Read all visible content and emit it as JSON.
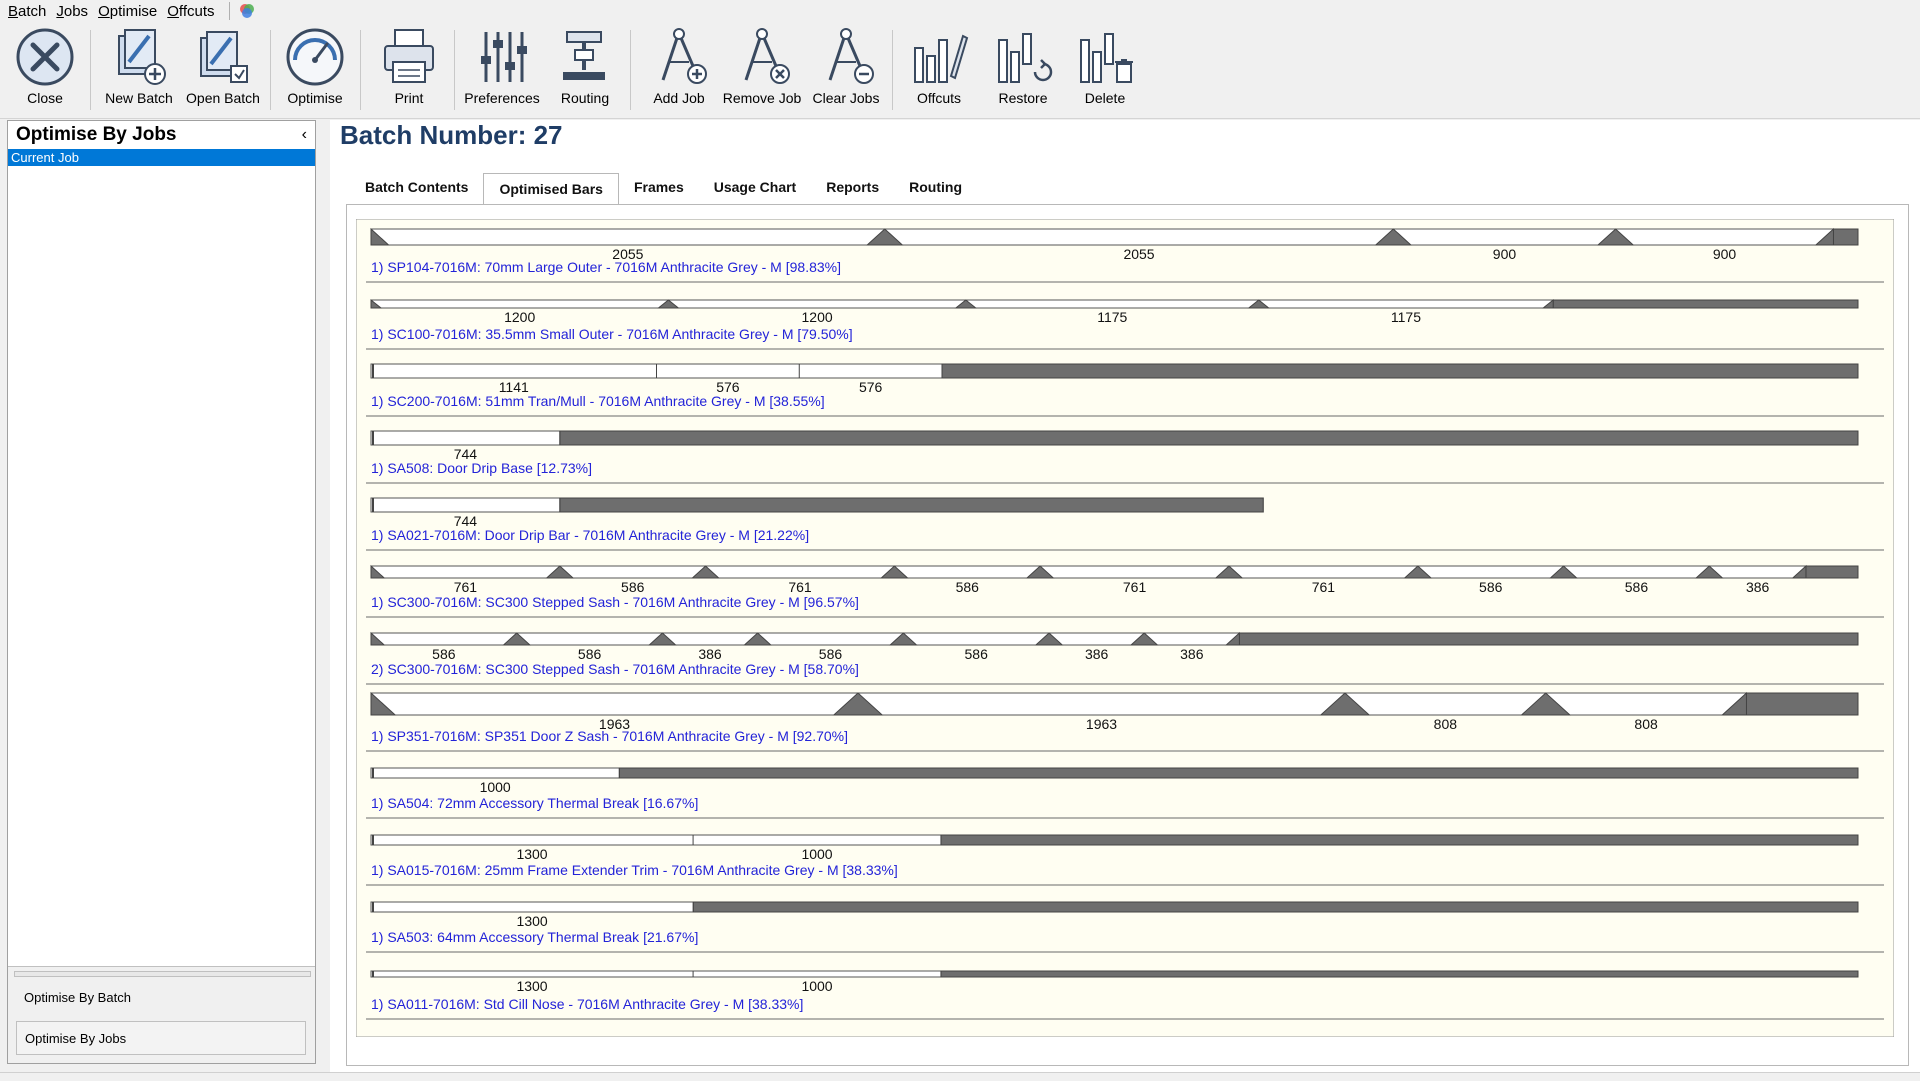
{
  "menu": [
    "Batch",
    "Jobs",
    "Optimise",
    "Offcuts"
  ],
  "toolbar": [
    {
      "id": "close",
      "label": "Close",
      "icon": "close-icon"
    },
    {
      "id": "new-batch",
      "label": "New Batch",
      "icon": "new-batch-icon"
    },
    {
      "id": "open-batch",
      "label": "Open Batch",
      "icon": "open-batch-icon"
    },
    {
      "id": "optimise",
      "label": "Optimise",
      "icon": "gauge-icon"
    },
    {
      "id": "print",
      "label": "Print",
      "icon": "printer-icon"
    },
    {
      "id": "preferences",
      "label": "Preferences",
      "icon": "sliders-icon"
    },
    {
      "id": "routing",
      "label": "Routing",
      "icon": "routing-icon"
    },
    {
      "id": "add-job",
      "label": "Add Job",
      "icon": "compass-add-icon"
    },
    {
      "id": "remove-job",
      "label": "Remove Job",
      "icon": "compass-remove-icon"
    },
    {
      "id": "clear-jobs",
      "label": "Clear Jobs",
      "icon": "compass-clear-icon"
    },
    {
      "id": "offcuts",
      "label": "Offcuts",
      "icon": "offcuts-icon"
    },
    {
      "id": "restore",
      "label": "Restore",
      "icon": "restore-icon"
    },
    {
      "id": "delete",
      "label": "Delete",
      "icon": "delete-icon"
    }
  ],
  "left_panel": {
    "title": "Optimise By Jobs",
    "collapse_glyph": "‹",
    "current_item": "Current Job",
    "nav_batch": "Optimise By Batch",
    "nav_jobs": "Optimise By Jobs"
  },
  "batch": {
    "title": "Batch Number: 27"
  },
  "tabs": [
    "Batch Contents",
    "Optimised Bars",
    "Frames",
    "Usage Chart",
    "Reports",
    "Routing"
  ],
  "active_tab": 1,
  "colors": {
    "bar_bg": "#fffef2",
    "waste": "#6e6e6e",
    "label": "#2323d8",
    "accent": "#0078d7",
    "title": "#1f3d66"
  },
  "bars": [
    {
      "label": "1) SP104-7016M: 70mm Large Outer - 7016M Anthracite Grey - M [98.83%]",
      "style": "mitre",
      "h": 16,
      "pieces": [
        {
          "len": "2055",
          "a": 0,
          "b": 0.3455
        },
        {
          "len": "2055",
          "a": 0.3455,
          "b": 0.6875
        },
        {
          "len": "900",
          "a": 0.6875,
          "b": 0.837
        },
        {
          "len": "900",
          "a": 0.837,
          "b": 0.9835
        }
      ],
      "waste_start": 0.9835
    },
    {
      "label": "1) SC100-7016M: 35.5mm Small Outer - 7016M Anthracite Grey - M [79.50%]",
      "style": "mitre",
      "h": 8,
      "pieces": [
        {
          "len": "1200",
          "a": 0,
          "b": 0.2
        },
        {
          "len": "1200",
          "a": 0.2,
          "b": 0.4
        },
        {
          "len": "1175",
          "a": 0.4,
          "b": 0.597
        },
        {
          "len": "1175",
          "a": 0.597,
          "b": 0.795
        }
      ],
      "waste_start": 0.795
    },
    {
      "label": "1) SC200-7016M: 51mm Tran/Mull - 7016M Anthracite Grey - M [38.55%]",
      "style": "square",
      "h": 14,
      "pieces": [
        {
          "len": "1141",
          "a": 0,
          "b": 0.192
        },
        {
          "len": "576",
          "a": 0.192,
          "b": 0.288
        },
        {
          "len": "576",
          "a": 0.288,
          "b": 0.384
        }
      ],
      "waste_start": 0.384
    },
    {
      "label": "1) SA508: Door Drip Base [12.73%]",
      "style": "square",
      "h": 14,
      "pieces": [
        {
          "len": "744",
          "a": 0,
          "b": 0.127
        }
      ],
      "waste_start": 0.127
    },
    {
      "label": "1) SA021-7016M: Door Drip Bar - 7016M Anthracite Grey - M [21.22%]",
      "style": "square",
      "h": 14,
      "total": 0.6,
      "pieces": [
        {
          "len": "744",
          "a": 0,
          "b": 0.127
        }
      ],
      "waste_start": 0.127
    },
    {
      "label": "1) SC300-7016M: SC300 Stepped Sash - 7016M Anthracite Grey - M [96.57%]",
      "style": "mitre",
      "h": 12,
      "pieces": [
        {
          "len": "761",
          "a": 0,
          "b": 0.127
        },
        {
          "len": "586",
          "a": 0.127,
          "b": 0.225
        },
        {
          "len": "761",
          "a": 0.225,
          "b": 0.352
        },
        {
          "len": "586",
          "a": 0.352,
          "b": 0.45
        },
        {
          "len": "761",
          "a": 0.45,
          "b": 0.577
        },
        {
          "len": "761",
          "a": 0.577,
          "b": 0.704
        },
        {
          "len": "586",
          "a": 0.704,
          "b": 0.802
        },
        {
          "len": "586",
          "a": 0.802,
          "b": 0.9
        },
        {
          "len": "386",
          "a": 0.9,
          "b": 0.965
        }
      ],
      "waste_start": 0.965
    },
    {
      "label": "2) SC300-7016M: SC300 Stepped Sash - 7016M Anthracite Grey - M [58.70%]",
      "style": "mitre",
      "h": 12,
      "pieces": [
        {
          "len": "586",
          "a": 0,
          "b": 0.098
        },
        {
          "len": "586",
          "a": 0.098,
          "b": 0.196
        },
        {
          "len": "386",
          "a": 0.196,
          "b": 0.26
        },
        {
          "len": "586",
          "a": 0.26,
          "b": 0.358
        },
        {
          "len": "586",
          "a": 0.358,
          "b": 0.456
        },
        {
          "len": "386",
          "a": 0.456,
          "b": 0.52
        },
        {
          "len": "386",
          "a": 0.52,
          "b": 0.584
        }
      ],
      "waste_start": 0.584
    },
    {
      "label": "1) SP351-7016M: SP351 Door Z Sash - 7016M Anthracite Grey - M [92.70%]",
      "style": "mitre",
      "h": 22,
      "pieces": [
        {
          "len": "1963",
          "a": 0,
          "b": 0.3275
        },
        {
          "len": "1963",
          "a": 0.3275,
          "b": 0.655
        },
        {
          "len": "808",
          "a": 0.655,
          "b": 0.79
        },
        {
          "len": "808",
          "a": 0.79,
          "b": 0.925
        }
      ],
      "waste_start": 0.925
    },
    {
      "label": "1) SA504: 72mm Accessory Thermal Break [16.67%]",
      "style": "square",
      "h": 10,
      "pieces": [
        {
          "len": "1000",
          "a": 0,
          "b": 0.167
        }
      ],
      "waste_start": 0.167
    },
    {
      "label": "1) SA015-7016M: 25mm Frame Extender Trim - 7016M Anthracite Grey - M [38.33%]",
      "style": "square",
      "h": 10,
      "pieces": [
        {
          "len": "1300",
          "a": 0,
          "b": 0.2166
        },
        {
          "len": "1000",
          "a": 0.2166,
          "b": 0.3833
        }
      ],
      "waste_start": 0.3833
    },
    {
      "label": "1) SA503: 64mm Accessory Thermal Break [21.67%]",
      "style": "square",
      "h": 10,
      "pieces": [
        {
          "len": "1300",
          "a": 0,
          "b": 0.2167
        }
      ],
      "waste_start": 0.2167
    },
    {
      "label": "1) SA011-7016M: Std Cill Nose - 7016M Anthracite Grey - M [38.33%]",
      "style": "square",
      "h": 6,
      "pieces": [
        {
          "len": "1300",
          "a": 0,
          "b": 0.2166
        },
        {
          "len": "1000",
          "a": 0.2166,
          "b": 0.3833
        }
      ],
      "waste_start": 0.3833
    }
  ]
}
